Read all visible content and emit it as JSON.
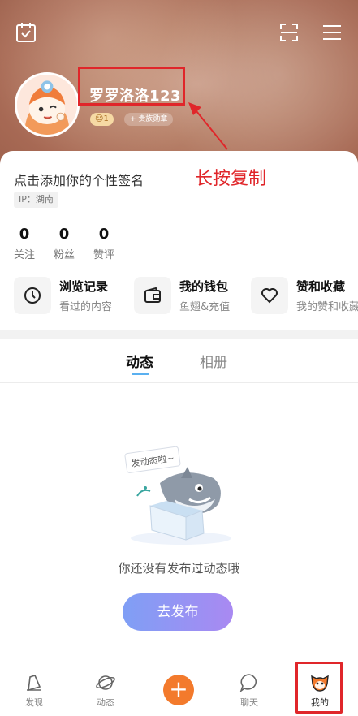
{
  "header": {
    "calendar_icon": "calendar-check-icon",
    "scan_icon": "scan-icon",
    "menu_icon": "menu-icon"
  },
  "profile": {
    "username": "罗罗洛洛123",
    "level": "1",
    "medal_label": "+ 贵族勋章",
    "signature": "点击添加你的个性签名",
    "ip": "IP：湖南"
  },
  "annotation": {
    "text": "长按复制",
    "color": "#e0262a"
  },
  "stats": [
    {
      "value": "0",
      "label": "关注"
    },
    {
      "value": "0",
      "label": "粉丝"
    },
    {
      "value": "0",
      "label": "赞评"
    }
  ],
  "shortcuts": [
    {
      "title": "浏览记录",
      "subtitle": "看过的内容",
      "icon": "clock-icon"
    },
    {
      "title": "我的钱包",
      "subtitle": "鱼翅&充值",
      "icon": "wallet-icon"
    },
    {
      "title": "赞和收藏",
      "subtitle": "我的赞和收藏",
      "icon": "heart-icon"
    }
  ],
  "tabs": [
    {
      "label": "动态",
      "active": true
    },
    {
      "label": "相册",
      "active": false
    }
  ],
  "empty_state": {
    "bubble_text": "发动态啦~",
    "message": "你还没有发布过动态哦",
    "button_label": "去发布"
  },
  "bottom_nav": [
    {
      "label": "发现",
      "icon": "discover-icon"
    },
    {
      "label": "动态",
      "icon": "planet-icon"
    },
    {
      "label": "",
      "icon": "plus-icon"
    },
    {
      "label": "聊天",
      "icon": "chat-icon"
    },
    {
      "label": "我的",
      "icon": "mine-fox-icon",
      "active": true
    }
  ],
  "colors": {
    "accent_orange": "#f37a2c",
    "highlight_red": "#e0262a",
    "tab_indicator": "#5ab0f0"
  }
}
